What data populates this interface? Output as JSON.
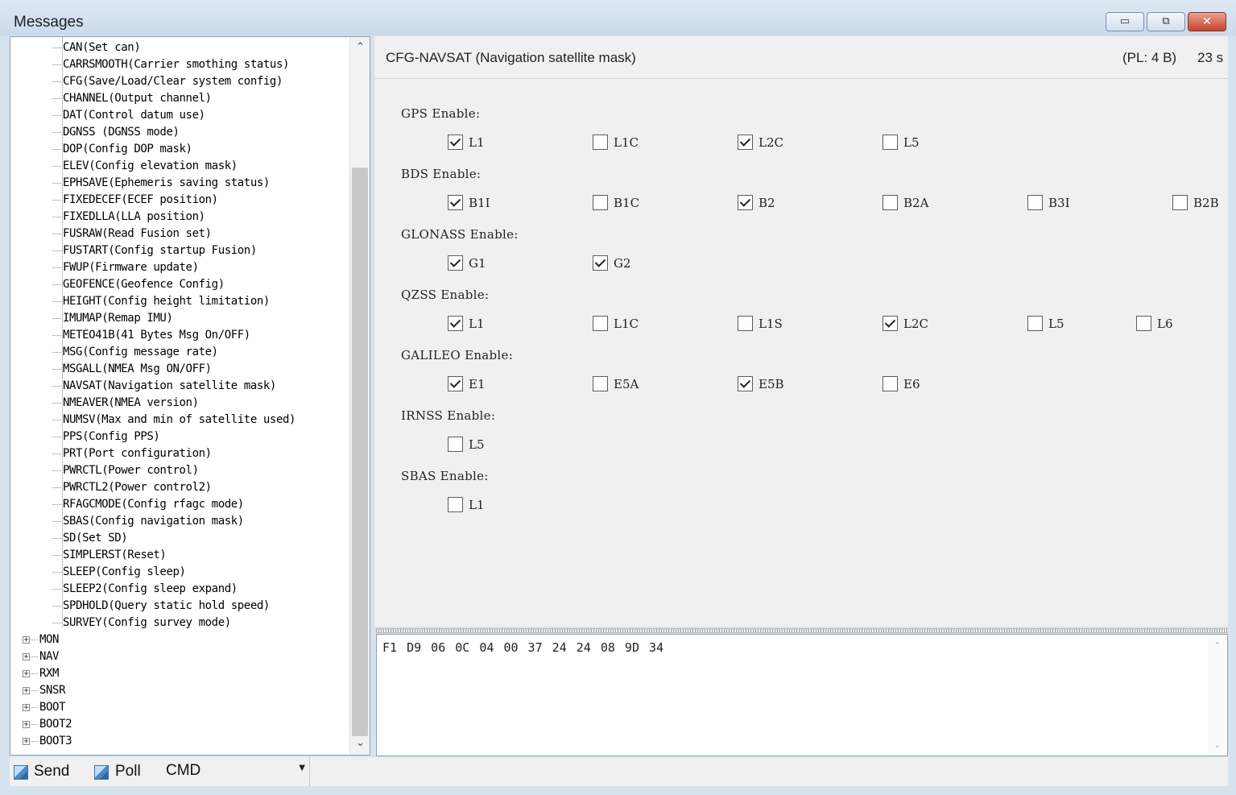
{
  "window": {
    "title": "Messages",
    "minimize_glyph": "▭",
    "restore_glyph": "⧉",
    "close_glyph": "✕"
  },
  "tree": {
    "children": [
      "CAN(Set can)",
      "CARRSMOOTH(Carrier smothing status)",
      "CFG(Save/Load/Clear system config)",
      "CHANNEL(Output channel)",
      "DAT(Control datum use)",
      "DGNSS (DGNSS mode)",
      "DOP(Config DOP mask)",
      "ELEV(Config elevation mask)",
      "EPHSAVE(Ephemeris saving status)",
      "FIXEDECEF(ECEF position)",
      "FIXEDLLA(LLA position)",
      "FUSRAW(Read Fusion set)",
      "FUSTART(Config startup Fusion)",
      "FWUP(Firmware update)",
      "GEOFENCE(Geofence Config)",
      "HEIGHT(Config height limitation)",
      "IMUMAP(Remap IMU)",
      "METEO41B(41 Bytes Msg On/OFF)",
      "MSG(Config message rate)",
      "MSGALL(NMEA Msg ON/OFF)",
      "NAVSAT(Navigation satellite mask)",
      "NMEAVER(NMEA version)",
      "NUMSV(Max and min of satellite used)",
      "PPS(Config PPS)",
      "PRT(Port configuration)",
      "PWRCTL(Power control)",
      "PWRCTL2(Power control2)",
      "RFAGCMODE(Config rfagc mode)",
      "SBAS(Config navigation mask)",
      "SD(Set SD)",
      "SIMPLERST(Reset)",
      "SLEEP(Config sleep)",
      "SLEEP2(Config sleep expand)",
      "SPDHOLD(Query static hold speed)",
      "SURVEY(Config survey mode)"
    ],
    "roots": [
      "MON",
      "NAV",
      "RXM",
      "SNSR",
      "BOOT",
      "BOOT2",
      "BOOT3"
    ],
    "expander_glyph": "+",
    "scroll_up": "⌃",
    "scroll_down": "⌄"
  },
  "header": {
    "title": "CFG-NAVSAT (Navigation satellite mask)",
    "pl": "(PL: 4 B)",
    "time": "23 s"
  },
  "groups": [
    {
      "label": "GPS Enable:",
      "items": [
        {
          "label": "L1",
          "checked": true
        },
        {
          "label": "L1C",
          "checked": false
        },
        {
          "label": "L2C",
          "checked": true
        },
        {
          "label": "L5",
          "checked": false
        }
      ]
    },
    {
      "label": "BDS Enable:",
      "items": [
        {
          "label": "B1I",
          "checked": true
        },
        {
          "label": "B1C",
          "checked": false
        },
        {
          "label": "B2",
          "checked": true
        },
        {
          "label": "B2A",
          "checked": false
        },
        {
          "label": "B3I",
          "checked": false
        },
        {
          "label": "B2B",
          "checked": false
        }
      ]
    },
    {
      "label": "GLONASS Enable:",
      "items": [
        {
          "label": "G1",
          "checked": true
        },
        {
          "label": "G2",
          "checked": true
        }
      ]
    },
    {
      "label": "QZSS Enable:",
      "items": [
        {
          "label": "L1",
          "checked": true
        },
        {
          "label": "L1C",
          "checked": false
        },
        {
          "label": "L1S",
          "checked": false
        },
        {
          "label": "L2C",
          "checked": true
        },
        {
          "label": "L5",
          "checked": false
        },
        {
          "label": "L6",
          "checked": false
        }
      ]
    },
    {
      "label": "GALILEO Enable:",
      "items": [
        {
          "label": "E1",
          "checked": true
        },
        {
          "label": "E5A",
          "checked": false
        },
        {
          "label": "E5B",
          "checked": true
        },
        {
          "label": "E6",
          "checked": false
        }
      ]
    },
    {
      "label": "IRNSS Enable:",
      "items": [
        {
          "label": "L5",
          "checked": false
        }
      ]
    },
    {
      "label": "SBAS Enable:",
      "items": [
        {
          "label": "L1",
          "checked": false
        }
      ]
    }
  ],
  "hex": {
    "text": "F1 D9 06 0C 04 00 37 24 24 08 9D 34",
    "scroll_up": "⌃",
    "scroll_down": "⌄"
  },
  "toolbar": {
    "send_label": "Send",
    "poll_label": "Poll",
    "cmd_value": "CMD",
    "cmd_arrow": "▼"
  }
}
